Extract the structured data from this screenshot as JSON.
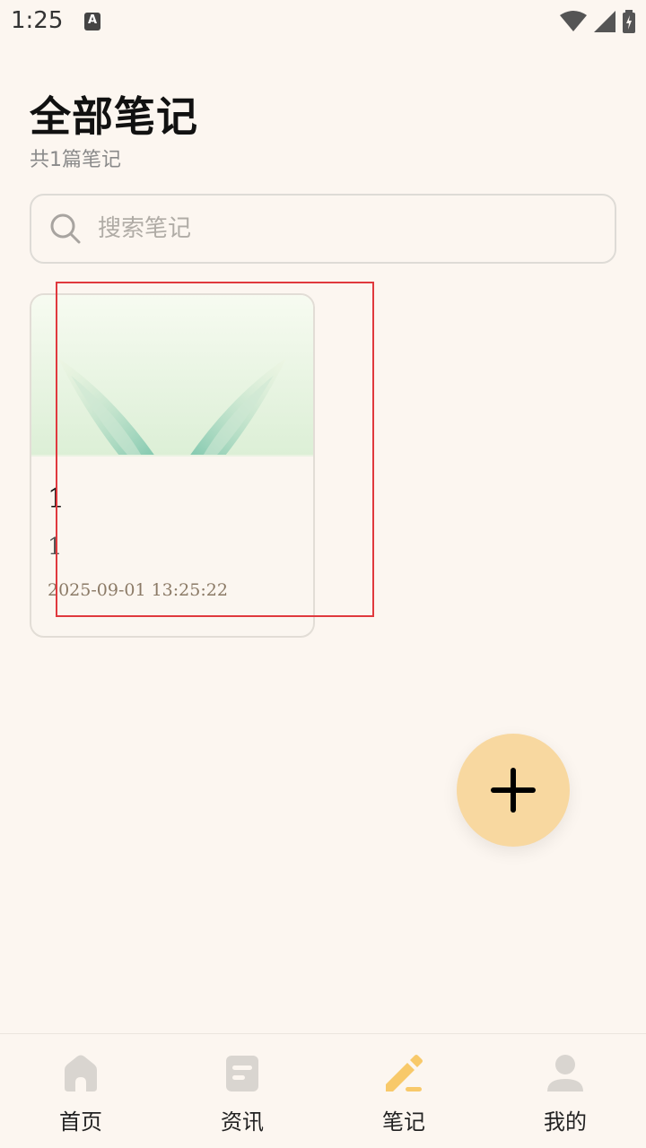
{
  "status_bar": {
    "time": "1:25",
    "a_icon_letter": "A"
  },
  "header": {
    "title": "全部笔记",
    "count_text": "共1篇笔记"
  },
  "search": {
    "placeholder": "搜索笔记"
  },
  "notes": [
    {
      "title": "1",
      "body": "1",
      "date": "2025-09-01 13:25:22"
    }
  ],
  "bottom_nav": {
    "items": [
      {
        "label": "首页",
        "icon": "home-icon",
        "active": false
      },
      {
        "label": "资讯",
        "icon": "news-icon",
        "active": false
      },
      {
        "label": "笔记",
        "icon": "edit-note-icon",
        "active": true
      },
      {
        "label": "我的",
        "icon": "profile-icon",
        "active": false
      }
    ]
  },
  "colors": {
    "background": "#fcf6f0",
    "accent": "#f8c96a",
    "fab": "#f8d8a0",
    "inactive_icon": "#d9d5d0",
    "selection": "#e0393e"
  }
}
